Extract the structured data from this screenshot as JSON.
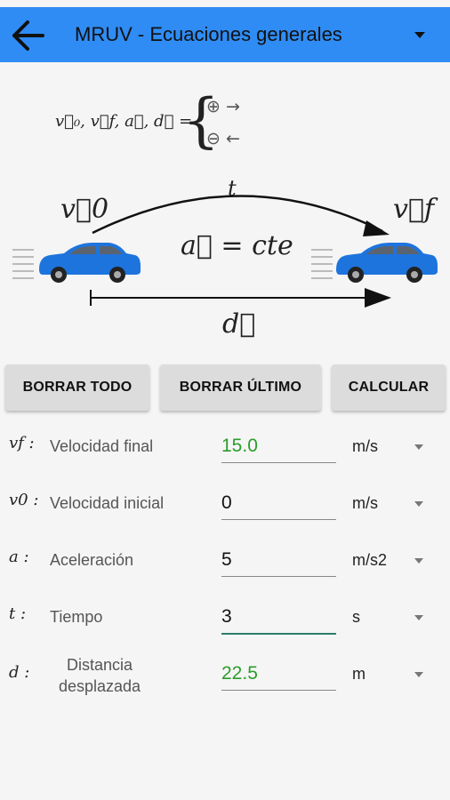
{
  "appbar": {
    "title": "MRUV - Ecuaciones generales",
    "back_icon": "arrow-left-icon",
    "menu_icon": "dropdown-triangle-icon",
    "color": "#2f8cf4"
  },
  "diagram": {
    "vectors_label": "v⃗₀, v⃗f, a⃗, d⃗ =",
    "positive_sign": "⊕ →",
    "negative_sign": "⊖ ←",
    "v0": "v⃗0",
    "vf": "v⃗f",
    "t": "t",
    "accel_eq": "a⃗ = cte",
    "d": "d⃗",
    "car_color": "#1e74dd"
  },
  "buttons": {
    "clear_all": "BORRAR TODO",
    "clear_last": "BORRAR ÚLTIMO",
    "calculate": "CALCULAR"
  },
  "fields": [
    {
      "symbol": "vf :",
      "label": "Velocidad final",
      "value": "15.0",
      "unit": "m/s",
      "computed": true
    },
    {
      "symbol": "v0 :",
      "label": "Velocidad inicial",
      "value": "0",
      "unit": "m/s",
      "computed": false
    },
    {
      "symbol": "a :",
      "label": "Aceleración",
      "value": "5",
      "unit": "m/s2",
      "computed": false
    },
    {
      "symbol": "t :",
      "label": "Tiempo",
      "value": "3",
      "unit": "s",
      "computed": false,
      "focused": true
    },
    {
      "symbol": "d :",
      "label": "Distancia desplazada",
      "value": "22.5",
      "unit": "m",
      "computed": true
    }
  ],
  "colors": {
    "computed_value": "#2a9d2a",
    "focused_underline": "#2e7d6e"
  }
}
